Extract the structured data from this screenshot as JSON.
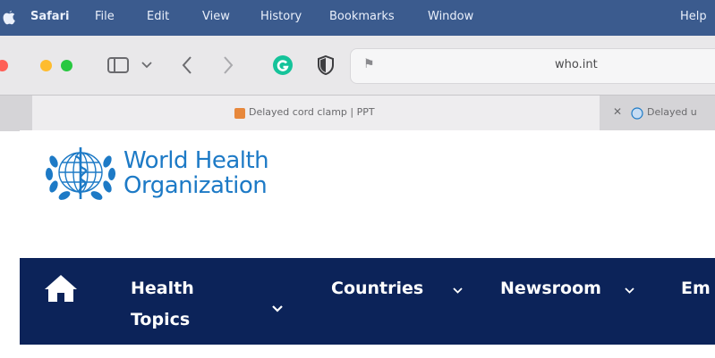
{
  "menubar": {
    "items": [
      "Safari",
      "File",
      "Edit",
      "View",
      "History",
      "Bookmarks",
      "Window",
      "Help"
    ]
  },
  "toolbar": {
    "address_url": "who.int"
  },
  "tabs": [
    {
      "title": "Delayed cord clamp | PPT"
    },
    {
      "title": "Delayed u"
    }
  ],
  "page": {
    "org_name_line1": "World Health",
    "org_name_line2": "Organization",
    "nav": {
      "health_topics_line1": "Health",
      "health_topics_line2": "Topics",
      "countries": "Countries",
      "newsroom": "Newsroom",
      "emergencies_partial": "Em"
    }
  },
  "colors": {
    "menubar_bg": "#3b5b8e",
    "brand_blue": "#1d7ac6",
    "nav_bg": "#0c2359",
    "traffic_red": "#ff5f57",
    "traffic_yellow": "#febc2e",
    "traffic_green": "#28c840"
  },
  "icons": [
    "apple-icon",
    "sidebar-icon",
    "chevron-down-icon",
    "back-icon",
    "forward-icon",
    "grammarly-icon",
    "privacy-shield-icon",
    "flag-icon",
    "home-icon",
    "who-emblem-icon"
  ]
}
